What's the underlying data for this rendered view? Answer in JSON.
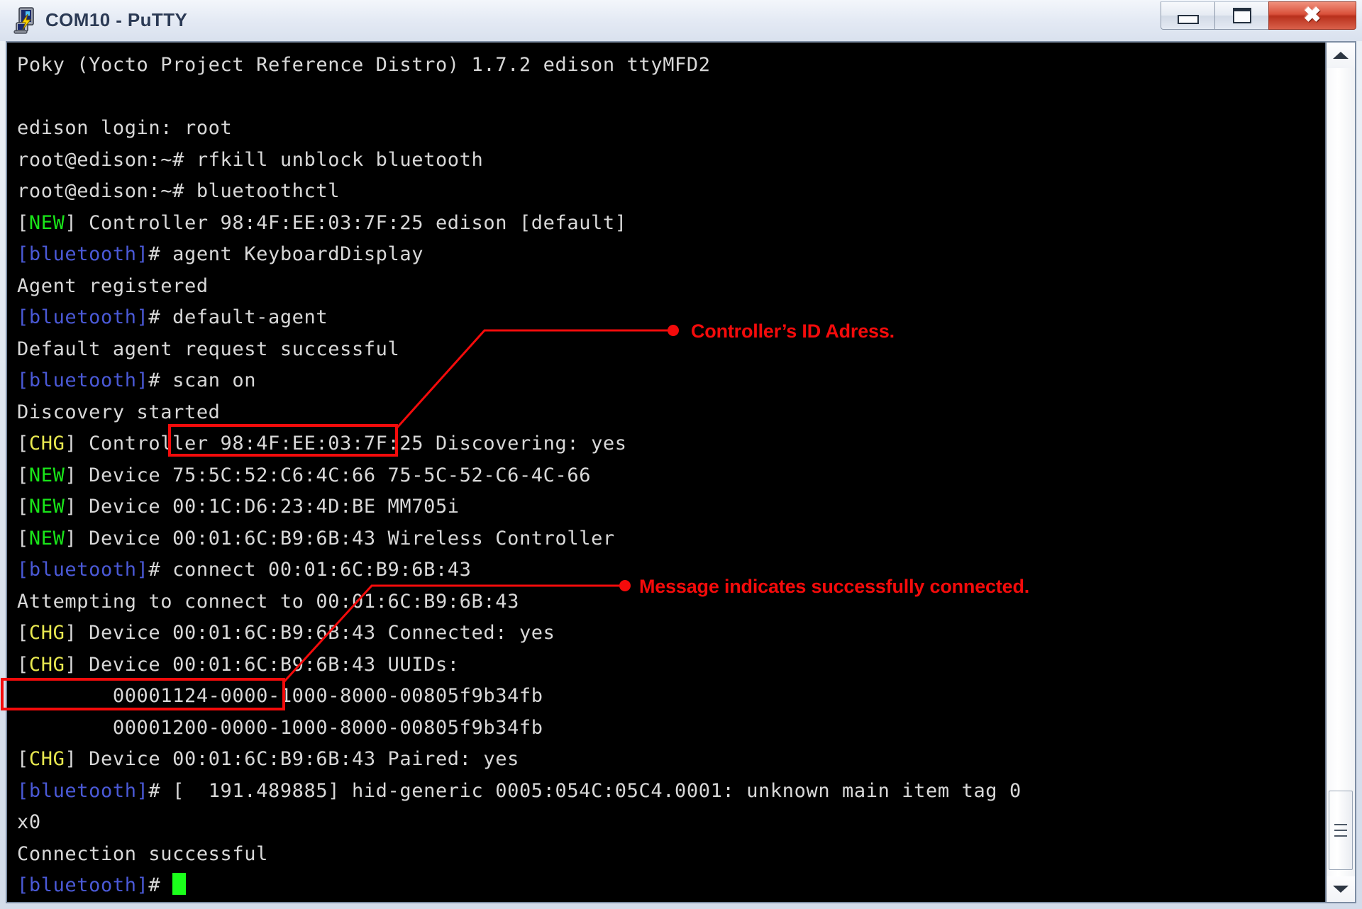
{
  "window": {
    "title": "COM10 - PuTTY",
    "icon": "putty-icon",
    "controls": {
      "minimize_label": "–",
      "maximize_label": "□",
      "close_label": "✕"
    }
  },
  "terminal": {
    "background_color": "#000000",
    "foreground_color": "#d8d8d8",
    "cursor_color": "#1bff1b",
    "colors": {
      "new_tag": "#19e619",
      "chg_tag": "#e8e84f",
      "prompt_tag": "#4a59d6"
    },
    "lines": [
      {
        "segments": [
          {
            "text": "Poky (Yocto Project Reference Distro) 1.7.2 edison ttyMFD2",
            "color": "white"
          }
        ]
      },
      {
        "segments": [
          {
            "text": "",
            "color": "white"
          }
        ]
      },
      {
        "segments": [
          {
            "text": "edison login: root",
            "color": "white"
          }
        ]
      },
      {
        "segments": [
          {
            "text": "root@edison:~# rfkill unblock bluetooth",
            "color": "white"
          }
        ]
      },
      {
        "segments": [
          {
            "text": "root@edison:~# bluetoothctl",
            "color": "white"
          }
        ]
      },
      {
        "segments": [
          {
            "text": "[",
            "color": "white"
          },
          {
            "text": "NEW",
            "color": "new"
          },
          {
            "text": "] Controller 98:4F:EE:03:7F:25 edison [default]",
            "color": "white"
          }
        ]
      },
      {
        "segments": [
          {
            "text": "[bluetooth]",
            "color": "blue"
          },
          {
            "text": "# agent KeyboardDisplay",
            "color": "white"
          }
        ]
      },
      {
        "segments": [
          {
            "text": "Agent registered",
            "color": "white"
          }
        ]
      },
      {
        "segments": [
          {
            "text": "[bluetooth]",
            "color": "blue"
          },
          {
            "text": "# default-agent",
            "color": "white"
          }
        ]
      },
      {
        "segments": [
          {
            "text": "Default agent request successful",
            "color": "white"
          }
        ]
      },
      {
        "segments": [
          {
            "text": "[bluetooth]",
            "color": "blue"
          },
          {
            "text": "# scan on",
            "color": "white"
          }
        ]
      },
      {
        "segments": [
          {
            "text": "Discovery started",
            "color": "white"
          }
        ]
      },
      {
        "segments": [
          {
            "text": "[",
            "color": "white"
          },
          {
            "text": "CHG",
            "color": "chg"
          },
          {
            "text": "] Controller 98:4F:EE:03:7F:25 Discovering: yes",
            "color": "white"
          }
        ]
      },
      {
        "segments": [
          {
            "text": "[",
            "color": "white"
          },
          {
            "text": "NEW",
            "color": "new"
          },
          {
            "text": "] Device 75:5C:52:C6:4C:66 75-5C-52-C6-4C-66",
            "color": "white"
          }
        ]
      },
      {
        "segments": [
          {
            "text": "[",
            "color": "white"
          },
          {
            "text": "NEW",
            "color": "new"
          },
          {
            "text": "] Device 00:1C:D6:23:4D:BE MM705i",
            "color": "white"
          }
        ]
      },
      {
        "segments": [
          {
            "text": "[",
            "color": "white"
          },
          {
            "text": "NEW",
            "color": "new"
          },
          {
            "text": "] Device 00:01:6C:B9:6B:43 Wireless Controller",
            "color": "white"
          }
        ]
      },
      {
        "segments": [
          {
            "text": "[bluetooth]",
            "color": "blue"
          },
          {
            "text": "# connect 00:01:6C:B9:6B:43",
            "color": "white"
          }
        ]
      },
      {
        "segments": [
          {
            "text": "Attempting to connect to 00:01:6C:B9:6B:43",
            "color": "white"
          }
        ]
      },
      {
        "segments": [
          {
            "text": "[",
            "color": "white"
          },
          {
            "text": "CHG",
            "color": "chg"
          },
          {
            "text": "] Device 00:01:6C:B9:6B:43 Connected: yes",
            "color": "white"
          }
        ]
      },
      {
        "segments": [
          {
            "text": "[",
            "color": "white"
          },
          {
            "text": "CHG",
            "color": "chg"
          },
          {
            "text": "] Device 00:01:6C:B9:6B:43 UUIDs:",
            "color": "white"
          }
        ]
      },
      {
        "segments": [
          {
            "text": "        00001124-0000-1000-8000-00805f9b34fb",
            "color": "white"
          }
        ]
      },
      {
        "segments": [
          {
            "text": "        00001200-0000-1000-8000-00805f9b34fb",
            "color": "white"
          }
        ]
      },
      {
        "segments": [
          {
            "text": "[",
            "color": "white"
          },
          {
            "text": "CHG",
            "color": "chg"
          },
          {
            "text": "] Device 00:01:6C:B9:6B:43 Paired: yes",
            "color": "white"
          }
        ]
      },
      {
        "segments": [
          {
            "text": "[bluetooth]",
            "color": "blue"
          },
          {
            "text": "# [  191.489885] hid-generic 0005:054C:05C4.0001: unknown main item tag 0",
            "color": "white"
          }
        ]
      },
      {
        "segments": [
          {
            "text": "x0",
            "color": "white"
          }
        ]
      },
      {
        "segments": [
          {
            "text": "Connection successful",
            "color": "white"
          }
        ]
      },
      {
        "segments": [
          {
            "text": "[bluetooth]",
            "color": "blue"
          },
          {
            "text": "# ",
            "color": "white"
          },
          {
            "text": "",
            "color": "cursor"
          }
        ]
      }
    ]
  },
  "annotations": {
    "color": "#f40b0b",
    "items": [
      {
        "id": "controller-id-address",
        "text": "Controller’s ID Adress."
      },
      {
        "id": "connection-success",
        "text": "Message indicates successfully connected."
      }
    ]
  },
  "scrollbar": {
    "up_arrow": "scroll-up-arrow",
    "down_arrow": "scroll-down-arrow",
    "thumb": "scroll-thumb"
  }
}
